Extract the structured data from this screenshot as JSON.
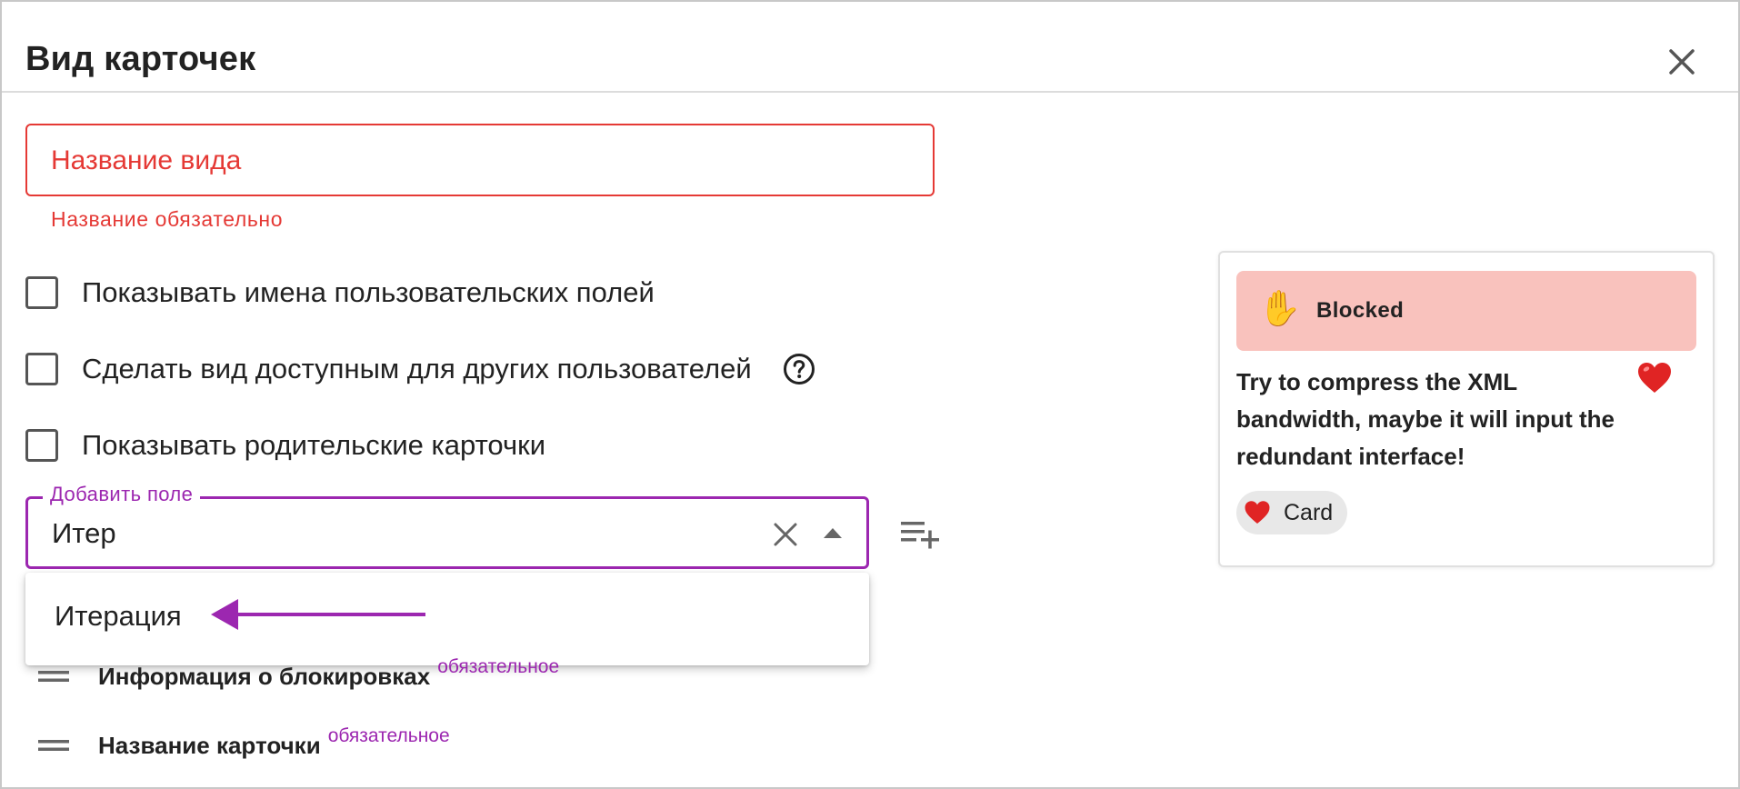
{
  "dialog": {
    "title": "Вид карточек",
    "close_icon": "close-icon"
  },
  "name_field": {
    "placeholder": "Название вида",
    "value": "",
    "error": "Название обязательно"
  },
  "options": [
    {
      "label": "Показывать имена пользовательских полей",
      "checked": false
    },
    {
      "label": "Сделать вид доступным для других пользователей",
      "checked": false,
      "help_icon": "help-circle-icon"
    },
    {
      "label": "Показывать родительские карточки",
      "checked": false
    }
  ],
  "add_field": {
    "legend": "Добавить поле",
    "value": "Итер",
    "clear_icon": "clear-icon",
    "toggle_icon": "arrow-up-icon",
    "add_icon": "playlist-add-icon"
  },
  "dropdown": {
    "options": [
      "Итерация"
    ],
    "annotation": "arrow-left-annotation"
  },
  "fields": [
    {
      "name": "Информация о блокировках",
      "required": "обязательное"
    },
    {
      "name": "Название карточки",
      "required": "обязательное"
    }
  ],
  "preview": {
    "blocked_label": "Blocked",
    "blocked_icon": "raised-hand-icon",
    "card_text": "Try to compress the XML bandwidth, maybe it will input the redundant interface!",
    "heart_icon": "heart-icon",
    "chip_label": "Card",
    "colors": {
      "blocked_bg": "#f9c2bd",
      "heart": "#e02424",
      "accent": "#9c27b0",
      "error": "#e53935"
    }
  }
}
